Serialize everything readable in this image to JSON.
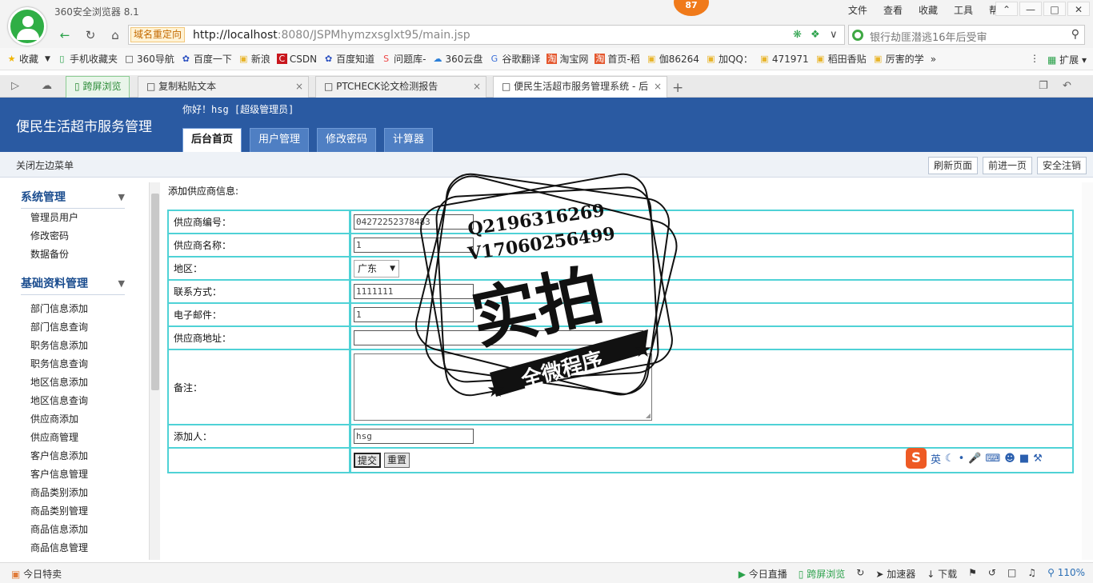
{
  "browser": {
    "app_title": "360安全浏览器 8.1",
    "badge": "87",
    "top_menu": [
      "文件",
      "查看",
      "收藏",
      "工具",
      "帮助"
    ],
    "window_buttons": [
      "⌃",
      "—",
      "□",
      "✕"
    ],
    "redirect_label": "域名重定向",
    "url_host": "http://localhost",
    "url_rest": ":8080/JSPMhymzxsglxt95/main.jsp",
    "search_text": "银行劫匪潜逃16年后受审",
    "bookmarks": [
      "收藏",
      "手机收藏夹",
      "360导航",
      "百度一下",
      "新浪",
      "CSDN",
      "百度知道",
      "问题库-",
      "360云盘",
      "谷歌翻译",
      "淘宝网",
      "首页-稻",
      "伽86264",
      "加QQ：",
      "471971",
      "稻田香贴",
      "厉害的学"
    ],
    "bookmarks_more": "»",
    "extension_label": "扩展",
    "tabs": [
      {
        "label": "跨屏浏览"
      },
      {
        "label": "复制粘贴文本"
      },
      {
        "label": "PTCHECK论文检测报告"
      },
      {
        "label": "便民生活超市服务管理系统 - 后"
      }
    ],
    "new_tab": "+"
  },
  "header": {
    "system_title": "便民生活超市服务管理",
    "greeting": "你好！hsg [超级管理员]",
    "tabs": [
      "后台首页",
      "用户管理",
      "修改密码",
      "计算器"
    ]
  },
  "subbar": {
    "close_menu": "关闭左边菜单",
    "buttons": [
      "刷新页面",
      "前进一页",
      "安全注销"
    ]
  },
  "sidebar": {
    "groups": [
      {
        "title": "系统管理",
        "items": [
          "管理员用户",
          "修改密码",
          "数据备份"
        ]
      },
      {
        "title": "基础资料管理",
        "items": [
          "部门信息添加",
          "部门信息查询",
          "职务信息添加",
          "职务信息查询",
          "地区信息添加",
          "地区信息查询",
          "供应商添加",
          "供应商管理",
          "客户信息添加",
          "客户信息管理",
          "商品类别添加",
          "商品类别管理",
          "商品信息添加",
          "商品信息管理"
        ]
      }
    ]
  },
  "form": {
    "heading": "添加供应商信息:",
    "labels": [
      "供应商编号：",
      "供应商名称：",
      "地区：",
      "联系方式：",
      "电子邮件：",
      "供应商地址：",
      "备注：",
      "添加人："
    ],
    "values": {
      "supplier_no": "04272252378483",
      "supplier_name": "1",
      "region": "广东",
      "contact": "1111111",
      "email": "1",
      "address": "",
      "remark": "",
      "added_by": "hsg"
    },
    "submit": "提交",
    "reset": "重置"
  },
  "watermark": {
    "line1": "Q2196316269",
    "line2": "V17060256499",
    "big": "实拍",
    "ribbon": "全微程序"
  },
  "ime": {
    "lang": "英"
  },
  "statusbar": {
    "left": "今日特卖",
    "right": [
      "今日直播",
      "跨屏浏览",
      "加速器",
      "下载",
      "110%"
    ]
  }
}
